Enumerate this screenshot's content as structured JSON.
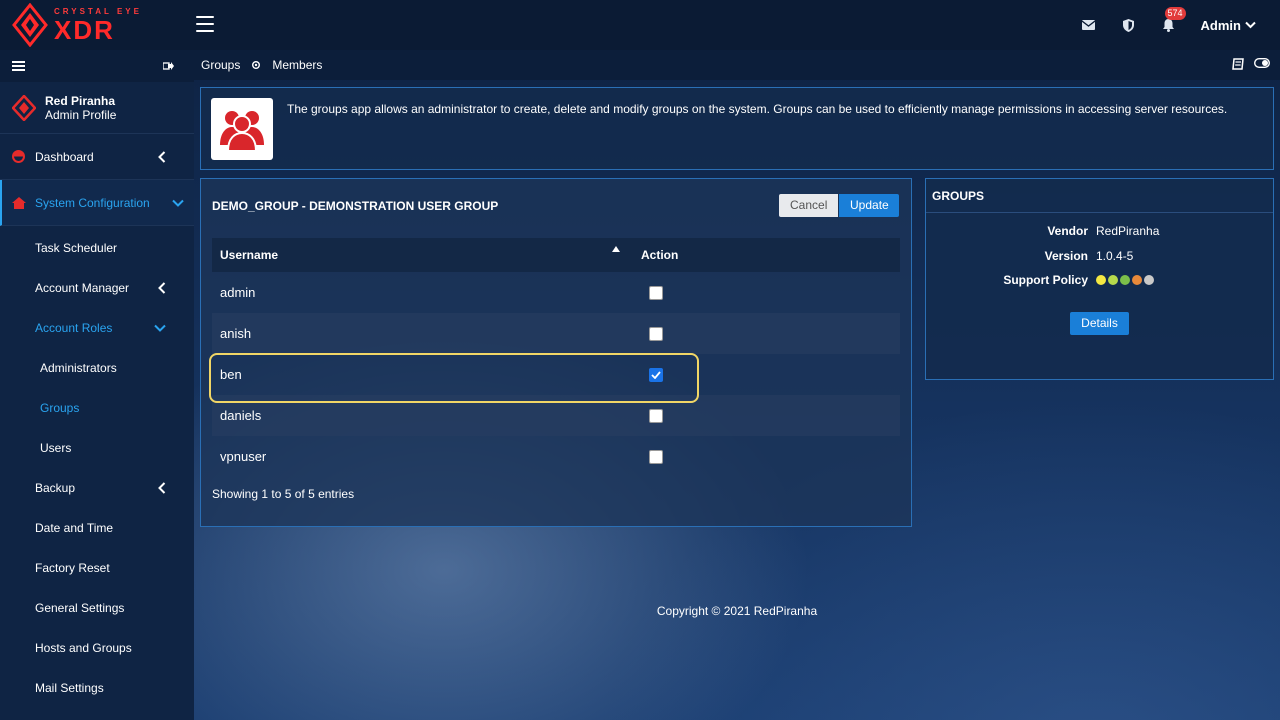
{
  "brand": {
    "small": "CRYSTAL EYE",
    "big": "XDR",
    "accent": "#ff2a2a"
  },
  "topbar": {
    "notification_count": "574",
    "user_menu": "Admin",
    "icons": [
      "mail-icon",
      "shield-icon",
      "bell-icon"
    ]
  },
  "sidebar": {
    "profile": {
      "name": "Red Piranha",
      "role": "Admin Profile"
    },
    "items": [
      {
        "label": "Dashboard"
      },
      {
        "label": "System Configuration"
      },
      {
        "label": "Task Scheduler"
      },
      {
        "label": "Account Manager"
      },
      {
        "label": "Account Roles"
      },
      {
        "label": "Administrators"
      },
      {
        "label": "Groups"
      },
      {
        "label": "Users"
      },
      {
        "label": "Backup"
      },
      {
        "label": "Date and Time"
      },
      {
        "label": "Factory Reset"
      },
      {
        "label": "General Settings"
      },
      {
        "label": "Hosts and Groups"
      },
      {
        "label": "Mail Settings"
      }
    ]
  },
  "breadcrumb": {
    "items": [
      "Groups",
      "Members"
    ]
  },
  "info": {
    "text": "The groups app allows an administrator to create, delete and modify groups on the system. Groups can be used to efficiently manage permissions in accessing server resources."
  },
  "group": {
    "title": "DEMO_GROUP - DEMONSTRATION USER GROUP",
    "cancel_label": "Cancel",
    "update_label": "Update",
    "columns": [
      "Username",
      "Action"
    ],
    "rows": [
      {
        "username": "admin",
        "checked": false
      },
      {
        "username": "anish",
        "checked": false
      },
      {
        "username": "ben",
        "checked": true
      },
      {
        "username": "daniels",
        "checked": false
      },
      {
        "username": "vpnuser",
        "checked": false
      }
    ],
    "entries": "Showing 1 to 5 of 5 entries"
  },
  "groups_panel": {
    "title": "GROUPS",
    "vendor_label": "Vendor",
    "vendor": "RedPiranha",
    "version_label": "Version",
    "version": "1.0.4-5",
    "support_label": "Support Policy",
    "support_colors": [
      "#f4e842",
      "#b6d94c",
      "#7cbf4a",
      "#e8893a",
      "#c9c9c9"
    ],
    "details_label": "Details"
  },
  "footer": {
    "text": "Copyright © 2021 RedPiranha"
  }
}
